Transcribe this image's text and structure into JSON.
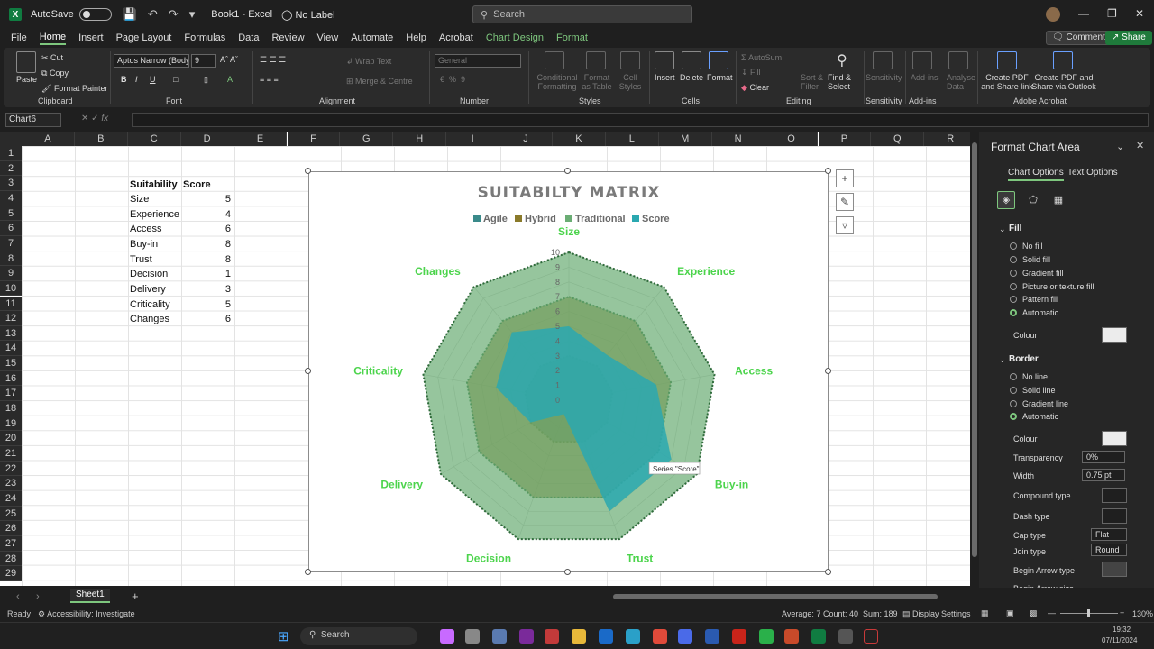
{
  "titlebar": {
    "autosave_label": "AutoSave",
    "doc_title": "Book1  -  Excel",
    "label_status": "No Label",
    "search_placeholder": "Search"
  },
  "menu": {
    "items": [
      "File",
      "Home",
      "Insert",
      "Page Layout",
      "Formulas",
      "Data",
      "Review",
      "View",
      "Automate",
      "Help",
      "Acrobat",
      "Chart Design",
      "Format"
    ],
    "active": "Home",
    "comments_label": "Comments",
    "share_label": "Share"
  },
  "ribbon": {
    "clipboard": {
      "paste": "Paste",
      "cut": "Cut",
      "copy": "Copy",
      "format_painter": "Format Painter",
      "label": "Clipboard"
    },
    "font": {
      "name": "Aptos Narrow (Body",
      "size": "9",
      "label": "Font"
    },
    "alignment": {
      "wrap_text": "Wrap Text",
      "merge_centre": "Merge & Centre",
      "label": "Alignment"
    },
    "number": {
      "format": "General",
      "label": "Number"
    },
    "styles": {
      "conditional": "Conditional Formatting",
      "format_table": "Format as Table",
      "cell_styles": "Cell Styles",
      "label": "Styles"
    },
    "cells": {
      "insert": "Insert",
      "delete": "Delete",
      "format": "Format",
      "label": "Cells"
    },
    "editing": {
      "autosum": "AutoSum",
      "fill": "Fill",
      "clear": "Clear",
      "sort_filter": "Sort & Filter",
      "find_select": "Find & Select",
      "label": "Editing"
    },
    "sensitivity": {
      "button": "Sensitivity",
      "label": "Sensitivity"
    },
    "addins": {
      "button": "Add-ins",
      "analyse": "Analyse Data",
      "label": "Add-ins"
    },
    "acrobat": {
      "create_share": "Create PDF and Share link",
      "create_outlook": "Create PDF and Share via Outlook",
      "label": "Adobe Acrobat"
    }
  },
  "formula_bar": {
    "name_box": "Chart6",
    "fx": "fx"
  },
  "columns": [
    "A",
    "B",
    "C",
    "D",
    "E",
    "F",
    "G",
    "H",
    "I",
    "J",
    "K",
    "L",
    "M",
    "N",
    "O",
    "P",
    "Q",
    "R"
  ],
  "rows": [
    "1",
    "2",
    "3",
    "4",
    "5",
    "6",
    "7",
    "8",
    "9",
    "10",
    "11",
    "12",
    "13",
    "14",
    "15",
    "16",
    "17",
    "18",
    "19",
    "20",
    "21",
    "22",
    "23",
    "24",
    "25",
    "26",
    "27",
    "28",
    "29"
  ],
  "table": {
    "header_label": "Suitability",
    "header_score": "Score",
    "rows": [
      {
        "label": "Size",
        "score": "5"
      },
      {
        "label": "Experience",
        "score": "4"
      },
      {
        "label": "Access",
        "score": "6"
      },
      {
        "label": "Buy-in",
        "score": "8"
      },
      {
        "label": "Trust",
        "score": "8"
      },
      {
        "label": "Decision",
        "score": "1"
      },
      {
        "label": "Delivery",
        "score": "3"
      },
      {
        "label": "Criticality",
        "score": "5"
      },
      {
        "label": "Changes",
        "score": "6"
      }
    ]
  },
  "chart_data": {
    "type": "radar",
    "title": "SUITABILTY MATRIX",
    "categories": [
      "Size",
      "Experience",
      "Access",
      "Buy-in",
      "Trust",
      "Decision",
      "Delivery",
      "Criticality",
      "Changes"
    ],
    "rlim": [
      0,
      10
    ],
    "ticks": [
      "0",
      "1",
      "2",
      "3",
      "4",
      "5",
      "6",
      "7",
      "8",
      "9",
      "10"
    ],
    "legend_position": "top",
    "tooltip": "Series \"Score\"",
    "series": [
      {
        "name": "Agile",
        "values": [
          3,
          3,
          3,
          3,
          3,
          3,
          3,
          3,
          3
        ],
        "color": "#3a8a8a"
      },
      {
        "name": "Hybrid",
        "values": [
          7,
          7,
          7,
          7,
          7,
          7,
          7,
          7,
          7
        ],
        "color": "#8a7a2a"
      },
      {
        "name": "Traditional",
        "values": [
          10,
          10,
          10,
          10,
          10,
          10,
          10,
          10,
          10
        ],
        "color": "#6aad74"
      },
      {
        "name": "Score",
        "values": [
          5,
          4,
          6,
          8,
          8,
          1,
          3,
          5,
          6
        ],
        "color": "#2aa8b0"
      }
    ]
  },
  "pane": {
    "title": "Format Chart Area",
    "tab_chart": "Chart Options",
    "tab_text": "Text Options",
    "fill": {
      "heading": "Fill",
      "options": [
        "No fill",
        "Solid fill",
        "Gradient fill",
        "Picture or texture fill",
        "Pattern fill",
        "Automatic"
      ],
      "selected": "Automatic",
      "colour": "Colour"
    },
    "border": {
      "heading": "Border",
      "options": [
        "No line",
        "Solid line",
        "Gradient line",
        "Automatic"
      ],
      "selected": "Automatic",
      "colour": "Colour",
      "transparency": "Transparency",
      "transparency_value": "0%",
      "width": "Width",
      "width_value": "0.75 pt",
      "compound": "Compound type",
      "dash": "Dash type",
      "cap": "Cap type",
      "cap_value": "Flat",
      "join": "Join type",
      "join_value": "Round",
      "begin_arrow": "Begin Arrow type",
      "begin_size": "Begin Arrow size"
    }
  },
  "sheet_tab": "Sheet1",
  "status": {
    "ready": "Ready",
    "accessibility": "Accessibility: Investigate",
    "average": "Average: 7",
    "count": "Count: 40",
    "sum": "Sum: 189",
    "display": "Display Settings",
    "zoom": "130%"
  },
  "taskbar": {
    "search": "Search",
    "time": "19:32",
    "date": "07/11/2024"
  }
}
